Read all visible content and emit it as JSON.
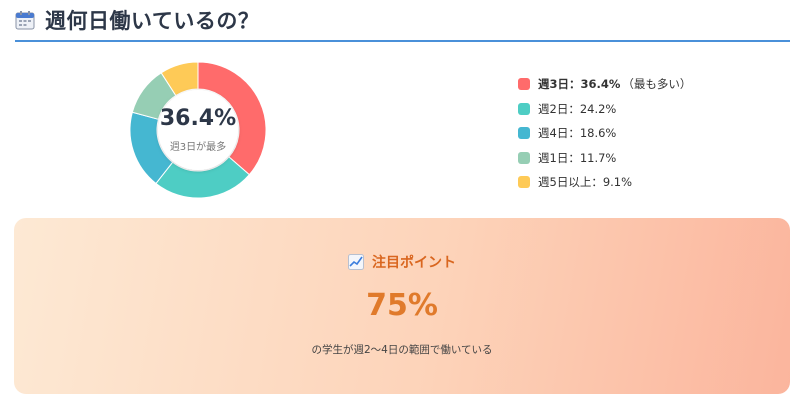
{
  "header": {
    "title": "週何日働いているの？",
    "icon": "calendar-icon"
  },
  "chart_data": {
    "type": "pie",
    "categories": [
      "週3日",
      "週2日",
      "週4日",
      "週1日",
      "週5日以上"
    ],
    "values": [
      36.4,
      24.2,
      18.6,
      11.7,
      9.1
    ],
    "colors": [
      "#ff6b6b",
      "#4ecdc4",
      "#45b7d1",
      "#96ceb4",
      "#feca57"
    ],
    "title": "",
    "center_value": "36.4%",
    "center_label": "週3日が最多",
    "legend_position": "right"
  },
  "legend": {
    "items": [
      {
        "label": "週3日：36.4%",
        "note": "（最も多い）",
        "color": "#ff6b6b"
      },
      {
        "label": "週2日：24.2%",
        "note": "",
        "color": "#4ecdc4"
      },
      {
        "label": "週4日：18.6%",
        "note": "",
        "color": "#45b7d1"
      },
      {
        "label": "週1日：11.7%",
        "note": "",
        "color": "#96ceb4"
      },
      {
        "label": "週5日以上：9.1%",
        "note": "",
        "color": "#feca57"
      }
    ]
  },
  "highlight": {
    "icon": "chart-increasing-icon",
    "title": "注目ポイント",
    "value": "75%",
    "description": "の学生が週2〜4日の範囲で働いている"
  }
}
